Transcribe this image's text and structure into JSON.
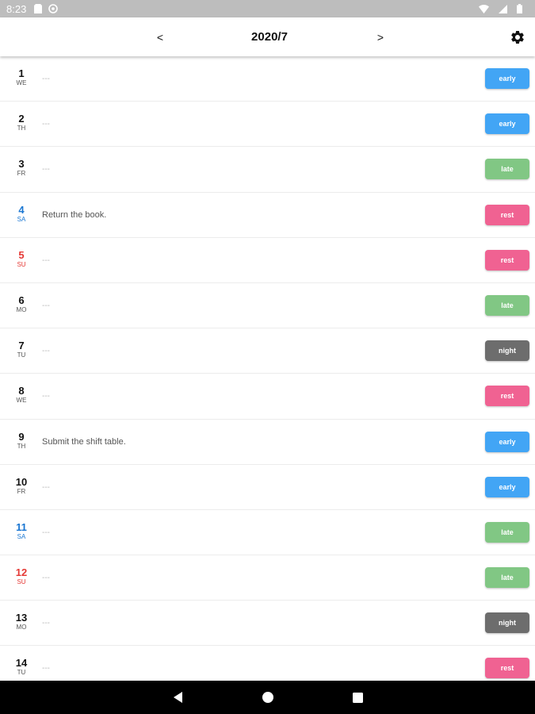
{
  "status_bar": {
    "time": "8:23",
    "icons": [
      "sd-card-icon",
      "sync-icon",
      "wifi-icon",
      "signal-icon",
      "battery-icon"
    ]
  },
  "header": {
    "prev_label": "<",
    "title": "2020/7",
    "next_label": ">",
    "settings_icon": "gear-icon"
  },
  "colors": {
    "early": "#42a5f5",
    "late": "#81c784",
    "rest": "#f06292",
    "night": "#6d6d6d",
    "saturday": "#1976d2",
    "sunday": "#e53935"
  },
  "days": [
    {
      "day": "1",
      "dow": "WE",
      "memo": "---",
      "shift": "early"
    },
    {
      "day": "2",
      "dow": "TH",
      "memo": "---",
      "shift": "early"
    },
    {
      "day": "3",
      "dow": "FR",
      "memo": "---",
      "shift": "late"
    },
    {
      "day": "4",
      "dow": "SA",
      "memo": "Return the book.",
      "shift": "rest"
    },
    {
      "day": "5",
      "dow": "SU",
      "memo": "---",
      "shift": "rest"
    },
    {
      "day": "6",
      "dow": "MO",
      "memo": "---",
      "shift": "late"
    },
    {
      "day": "7",
      "dow": "TU",
      "memo": "---",
      "shift": "night"
    },
    {
      "day": "8",
      "dow": "WE",
      "memo": "---",
      "shift": "rest"
    },
    {
      "day": "9",
      "dow": "TH",
      "memo": "Submit the shift table.",
      "shift": "early"
    },
    {
      "day": "10",
      "dow": "FR",
      "memo": "---",
      "shift": "early"
    },
    {
      "day": "11",
      "dow": "SA",
      "memo": "---",
      "shift": "late"
    },
    {
      "day": "12",
      "dow": "SU",
      "memo": "---",
      "shift": "late"
    },
    {
      "day": "13",
      "dow": "MO",
      "memo": "---",
      "shift": "night"
    },
    {
      "day": "14",
      "dow": "TU",
      "memo": "---",
      "shift": "rest"
    }
  ],
  "nav_bar": {
    "icons": [
      "back-icon",
      "home-icon",
      "recents-icon"
    ]
  }
}
